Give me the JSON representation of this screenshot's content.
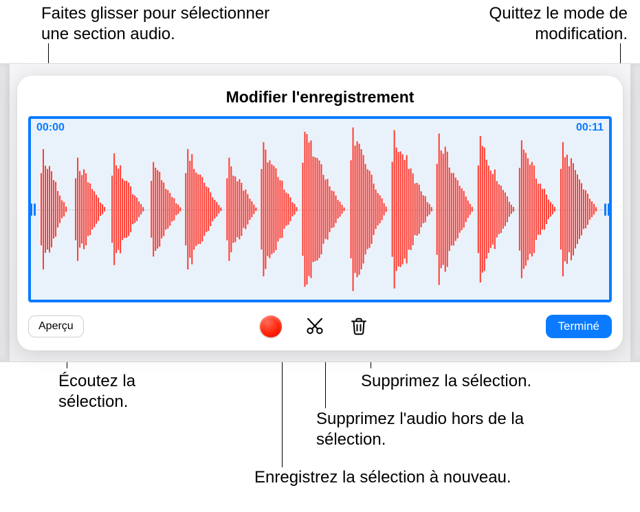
{
  "callouts": {
    "drag_select": "Faites glisser pour sélectionner une section audio.",
    "exit_edit": "Quittez le mode de modification.",
    "listen": "Écoutez la sélection.",
    "delete_sel": "Supprimez la sélection.",
    "trim_outside": "Supprimez l'audio hors de la sélection.",
    "rerecord": "Enregistrez la sélection à nouveau."
  },
  "editor": {
    "title": "Modifier l'enregistrement",
    "time_start": "00:00",
    "time_end": "00:11"
  },
  "toolbar": {
    "preview_label": "Aperçu",
    "done_label": "Terminé"
  },
  "colors": {
    "accent": "#0a7bff",
    "record": "#ff1e00",
    "wave": "#ff3b30"
  }
}
